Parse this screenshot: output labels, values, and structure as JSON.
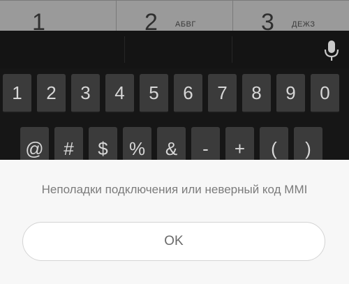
{
  "dialer": {
    "keys": [
      {
        "digit": "1",
        "letters": ""
      },
      {
        "digit": "2",
        "letters": "АБВГ"
      },
      {
        "digit": "3",
        "letters": "ДЕЖЗ"
      }
    ]
  },
  "keyboard": {
    "mic_icon": "microphone-icon",
    "digits": [
      "1",
      "2",
      "3",
      "4",
      "5",
      "6",
      "7",
      "8",
      "9",
      "0"
    ],
    "symbols": [
      "@",
      "#",
      "$",
      "%",
      "&",
      "-",
      "+",
      "(",
      ")"
    ]
  },
  "dialog": {
    "message": "Неполадки подключения или неверный код MMI",
    "ok_label": "OK"
  },
  "colors": {
    "keyboard_bg": "#161616",
    "key_bg": "#3b3b3b",
    "sheet_bg": "#f7f7f7",
    "button_border": "#d4d4d4"
  }
}
